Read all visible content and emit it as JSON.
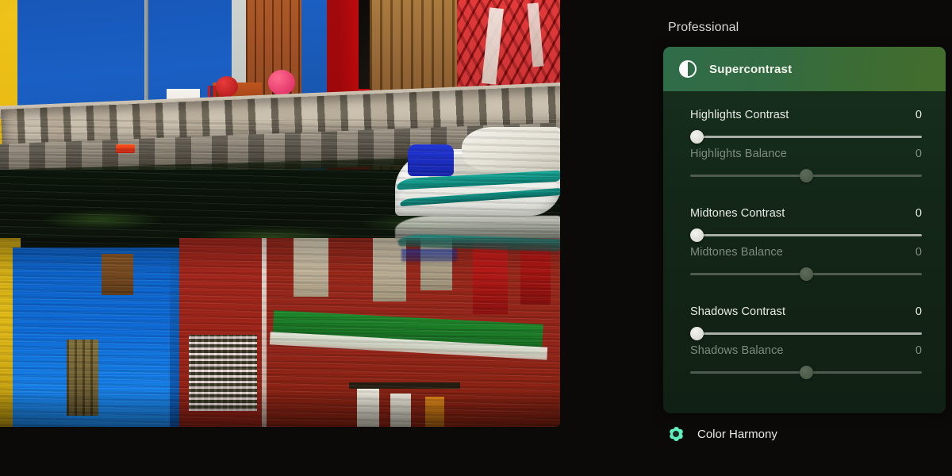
{
  "panel": {
    "section_title": "Professional",
    "card": {
      "title": "Supercontrast",
      "icon": "contrast-icon",
      "header_accent": "#336b42",
      "body_color": "#132718"
    },
    "sliders": [
      {
        "label": "Highlights Contrast",
        "value": "0",
        "knob_pct": 1,
        "active": true
      },
      {
        "label": "Highlights Balance",
        "value": "0",
        "knob_pct": 50,
        "active": false
      },
      {
        "label": "Midtones Contrast",
        "value": "0",
        "knob_pct": 1,
        "active": true
      },
      {
        "label": "Midtones Balance",
        "value": "0",
        "knob_pct": 50,
        "active": false
      },
      {
        "label": "Shadows Contrast",
        "value": "0",
        "knob_pct": 1,
        "active": true
      },
      {
        "label": "Shadows Balance",
        "value": "0",
        "knob_pct": 50,
        "active": false
      }
    ],
    "footer": {
      "label": "Color Harmony",
      "icon": "flower-icon",
      "icon_color": "#5ff0c0"
    }
  },
  "photo": {
    "description": "Canal waterfront with colorful houses and moored boat",
    "alt": "Burano-style colored facades reflected in canal water with white boat"
  }
}
